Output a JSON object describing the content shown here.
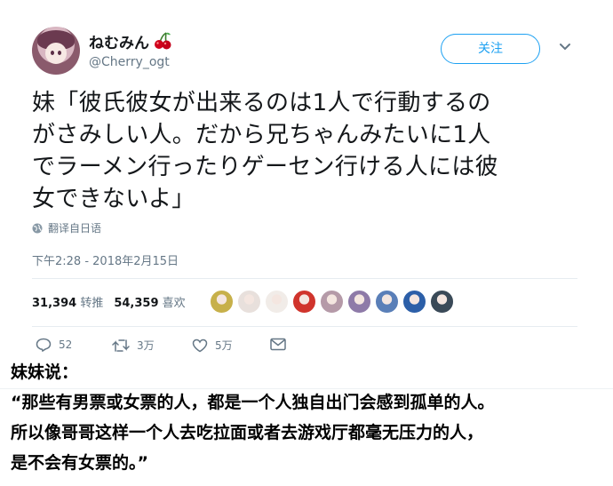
{
  "author": {
    "display_name": "ねむみん",
    "handle": "@Cherry_ogt"
  },
  "follow_button": {
    "label": "关注"
  },
  "tweet": {
    "lines": [
      "妹「彼氏彼女が出来るのは1人で行動するの",
      "がさみしい人。だから兄ちゃんみたいに1人",
      "でラーメン行ったりゲーセン行ける人には彼",
      "女できないよ」"
    ],
    "translate_label": "翻译自日语",
    "timestamp": "下午2:28 - 2018年2月15日"
  },
  "stats": {
    "retweets_count": "31,394",
    "retweets_label": "转推",
    "likes_count": "54,359",
    "likes_label": "喜欢",
    "liker_avatars": [
      "#c7b04a",
      "#e8e0dc",
      "#f1ece8",
      "#d0342c",
      "#b59aa8",
      "#8e7aa8",
      "#5a7fb8",
      "#2c5fa8",
      "#3a4a58"
    ]
  },
  "actions": {
    "replies": "52",
    "retweets": "3万",
    "likes": "5万"
  },
  "caption": {
    "lines": [
      "妹妹说：",
      "“那些有男票或女票的人，都是一个人独自出门会感到孤单的人。",
      "所以像哥哥这样一个人去吃拉面或者去游戏厅都毫无压力的人，",
      "是不会有女票的。”"
    ]
  },
  "colors": {
    "accent": "#1da1f2",
    "muted": "#657786",
    "cherry": "#d0021b"
  }
}
